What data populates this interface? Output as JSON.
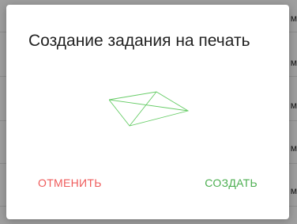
{
  "dialog": {
    "title": "Создание задания на печать",
    "cancel_label": "ОТМЕНИТЬ",
    "create_label": "СОЗДАТЬ"
  },
  "background": {
    "row_letters": [
      "м",
      "м",
      "м",
      "м",
      "м"
    ]
  },
  "colors": {
    "cancel": "#ef5b5b",
    "create": "#4caf50",
    "graphic": "#66cc66",
    "overlay": "#9e9e9e"
  },
  "icons": {
    "graphic": "wireframe-sheet-icon"
  }
}
